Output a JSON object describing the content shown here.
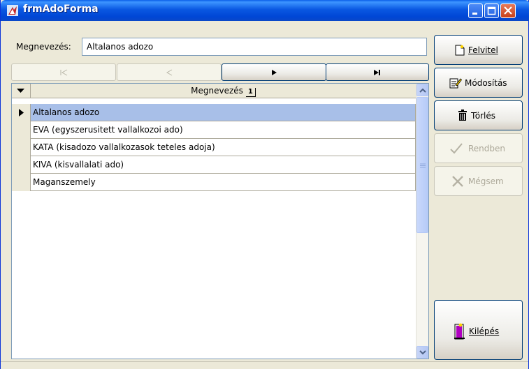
{
  "window": {
    "title": "frmAdoForma",
    "controls": [
      "minimize-icon",
      "maximize-icon",
      "close-icon"
    ]
  },
  "form": {
    "name_label": "Megnevezés:",
    "name_value": "Altalanos adozo"
  },
  "navigator": {
    "buttons": [
      {
        "icon": "first-record-icon",
        "enabled": false
      },
      {
        "icon": "prior-record-icon",
        "enabled": false
      },
      {
        "icon": "next-record-icon",
        "enabled": true
      },
      {
        "icon": "last-record-icon",
        "enabled": true
      }
    ]
  },
  "grid": {
    "column_header": "Megnevezés",
    "sort_index": "1",
    "rows": [
      {
        "text": "Altalanos adozo",
        "selected": true
      },
      {
        "text": "EVA (egyszerusitett vallalkozoi ado)",
        "selected": false
      },
      {
        "text": "KATA (kisadozo vallalkozasok teteles adoja)",
        "selected": false
      },
      {
        "text": "KIVA (kisvallalati ado)",
        "selected": false
      },
      {
        "text": "Maganszemely",
        "selected": false
      }
    ]
  },
  "actions": {
    "felvitel": "Felvitel",
    "modositas": "Módosítás",
    "torles": "Törlés",
    "rendben": "Rendben",
    "megsem": "Mégsem",
    "kilepes": "Kilépés"
  },
  "colors": {
    "selection": "#a8bfe8",
    "titlebar": "#0a58e2",
    "face": "#ece9d8"
  }
}
